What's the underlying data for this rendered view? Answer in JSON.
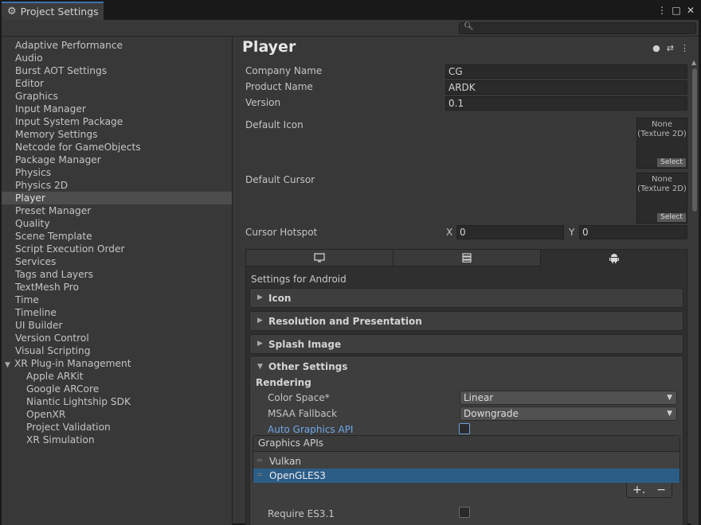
{
  "window": {
    "tab_title": "Project Settings",
    "controls": [
      "⋮",
      "□",
      "✕"
    ]
  },
  "search": {
    "placeholder": ""
  },
  "sidebar": {
    "items": [
      "Adaptive Performance",
      "Audio",
      "Burst AOT Settings",
      "Editor",
      "Graphics",
      "Input Manager",
      "Input System Package",
      "Memory Settings",
      "Netcode for GameObjects",
      "Package Manager",
      "Physics",
      "Physics 2D",
      "Player",
      "Preset Manager",
      "Quality",
      "Scene Template",
      "Script Execution Order",
      "Services",
      "Tags and Layers",
      "TextMesh Pro",
      "Time",
      "Timeline",
      "UI Builder",
      "Version Control",
      "Visual Scripting"
    ],
    "selected": "Player",
    "group": {
      "label": "XR Plug-in Management",
      "children": [
        "Apple ARKit",
        "Google ARCore",
        "Niantic Lightship SDK",
        "OpenXR",
        "Project Validation",
        "XR Simulation"
      ]
    }
  },
  "main": {
    "title": "Player",
    "header_icons": [
      "help-icon",
      "presets-icon",
      "more-icon"
    ],
    "company_label": "Company Name",
    "company_value": "CG",
    "product_label": "Product Name",
    "product_value": "ARDK",
    "version_label": "Version",
    "version_value": "0.1",
    "default_icon_label": "Default Icon",
    "default_cursor_label": "Default Cursor",
    "texture_none": "None",
    "texture_type": "(Texture 2D)",
    "select_label": "Select",
    "cursor_hotspot_label": "Cursor Hotspot",
    "x_label": "X",
    "x_value": "0",
    "y_label": "Y",
    "y_value": "0"
  },
  "platform": {
    "tabs": [
      "desktop-icon",
      "server-icon",
      "android-icon"
    ],
    "active_tab": "android-icon",
    "settings_for": "Settings for Android",
    "foldouts": [
      "Icon",
      "Resolution and Presentation",
      "Splash Image"
    ],
    "other": {
      "title": "Other Settings",
      "rendering": "Rendering",
      "color_space_label": "Color Space*",
      "color_space_value": "Linear",
      "msaa_label": "MSAA Fallback",
      "msaa_value": "Downgrade",
      "auto_api_label": "Auto Graphics API",
      "auto_api_checked": false,
      "apis_header": "Graphics APIs",
      "apis": [
        "Vulkan",
        "OpenGLES3"
      ],
      "selected_api": "OpenGLES3",
      "add_label": "+.",
      "remove_label": "−",
      "require_es31_label": "Require ES3.1",
      "require_es31_checked": false
    }
  },
  "colors": {
    "selection": "#2c5d87",
    "link": "#6fa7e8",
    "tab_accent": "#3a72b0"
  }
}
